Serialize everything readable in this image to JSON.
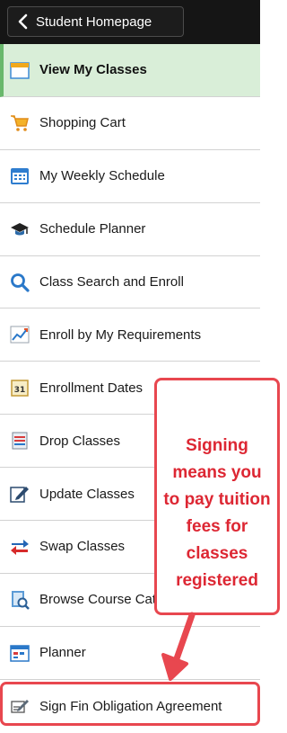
{
  "header": {
    "back_label": "Student Homepage"
  },
  "menu": {
    "items": [
      {
        "label": "View My Classes",
        "icon": "calendar-icon",
        "selected": true
      },
      {
        "label": "Shopping Cart",
        "icon": "cart-icon"
      },
      {
        "label": "My Weekly Schedule",
        "icon": "schedule-icon"
      },
      {
        "label": "Schedule Planner",
        "icon": "graduation-cap-icon"
      },
      {
        "label": "Class Search and Enroll",
        "icon": "search-icon"
      },
      {
        "label": "Enroll by My Requirements",
        "icon": "chart-line-icon"
      },
      {
        "label": "Enrollment Dates",
        "icon": "date-31-icon"
      },
      {
        "label": "Drop Classes",
        "icon": "drop-icon"
      },
      {
        "label": "Update Classes",
        "icon": "edit-icon"
      },
      {
        "label": "Swap Classes",
        "icon": "swap-icon"
      },
      {
        "label": "Browse Course Catalog",
        "icon": "catalog-icon"
      },
      {
        "label": "Planner",
        "icon": "planner-icon"
      },
      {
        "label": "Sign Fin Obligation Agreement",
        "icon": "sign-icon",
        "highlighted": true
      }
    ]
  },
  "callout": {
    "lines": [
      "Signing",
      "means you",
      "to pay tuition",
      "fees for",
      "classes",
      "registered"
    ]
  },
  "colors": {
    "annotation_red": "#e8474f",
    "selected_bg": "#d9eed8",
    "selected_border": "#69b86c",
    "topbar_bg": "#151515"
  }
}
